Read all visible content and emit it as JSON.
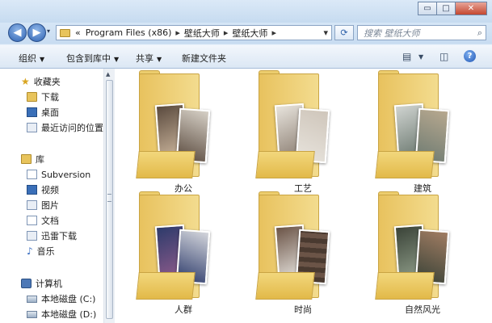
{
  "window": {
    "minimize": "▭",
    "maximize": "□",
    "close": "✕"
  },
  "nav": {
    "back": "◀",
    "forward": "▶",
    "chev": "▾",
    "crumbs": [
      "«",
      "Program Files (x86)",
      "壁纸大师",
      "壁纸大师"
    ],
    "crumb_sep": "▸",
    "refresh": "⟳",
    "search_placeholder": "搜索 壁纸大师",
    "search_icon": "⌕"
  },
  "toolbar": {
    "organize": "组织",
    "include_in_library": "包含到库中",
    "share": "共享",
    "new_folder": "新建文件夹",
    "view_icon": "▤",
    "preview_icon": "◫",
    "help": "?"
  },
  "sidebar": {
    "favorites": {
      "label": "收藏夹",
      "icon": "star-icon"
    },
    "favorites_items": [
      {
        "label": "下载",
        "icon": "downloads-folder-icon"
      },
      {
        "label": "桌面",
        "icon": "desktop-icon"
      },
      {
        "label": "最近访问的位置",
        "icon": "recent-places-icon"
      }
    ],
    "libraries": {
      "label": "库",
      "icon": "library-icon"
    },
    "libraries_items": [
      {
        "label": "Subversion",
        "icon": "subversion-icon"
      },
      {
        "label": "视频",
        "icon": "video-icon"
      },
      {
        "label": "图片",
        "icon": "pictures-icon"
      },
      {
        "label": "文档",
        "icon": "documents-icon"
      },
      {
        "label": "迅雷下载",
        "icon": "thunder-download-icon"
      },
      {
        "label": "音乐",
        "icon": "music-icon"
      }
    ],
    "computer": {
      "label": "计算机",
      "icon": "computer-icon"
    },
    "computer_items": [
      {
        "label": "本地磁盘 (C:)",
        "icon": "drive-c-icon"
      },
      {
        "label": "本地磁盘 (D:)",
        "icon": "drive-d-icon"
      }
    ]
  },
  "folders": [
    {
      "name": "办公",
      "colors": [
        "#5a4a3e",
        "#c9b39a",
        "#d6d0c6"
      ]
    },
    {
      "name": "工艺",
      "colors": [
        "#e7e3dc",
        "#8f8276",
        "#cfc6bb"
      ]
    },
    {
      "name": "建筑",
      "colors": [
        "#cfd3d0",
        "#6e7b72",
        "#b7a88f"
      ]
    },
    {
      "name": "人群",
      "colors": [
        "#2d3b6b",
        "#8c5a8a",
        "#d4d6dc"
      ]
    },
    {
      "name": "时尚",
      "colors": [
        "#6b5447",
        "#e2ded8",
        "#4a3a30"
      ]
    },
    {
      "name": "自然风光",
      "colors": [
        "#3a4338",
        "#a07c62",
        "#8c9a86"
      ]
    }
  ]
}
